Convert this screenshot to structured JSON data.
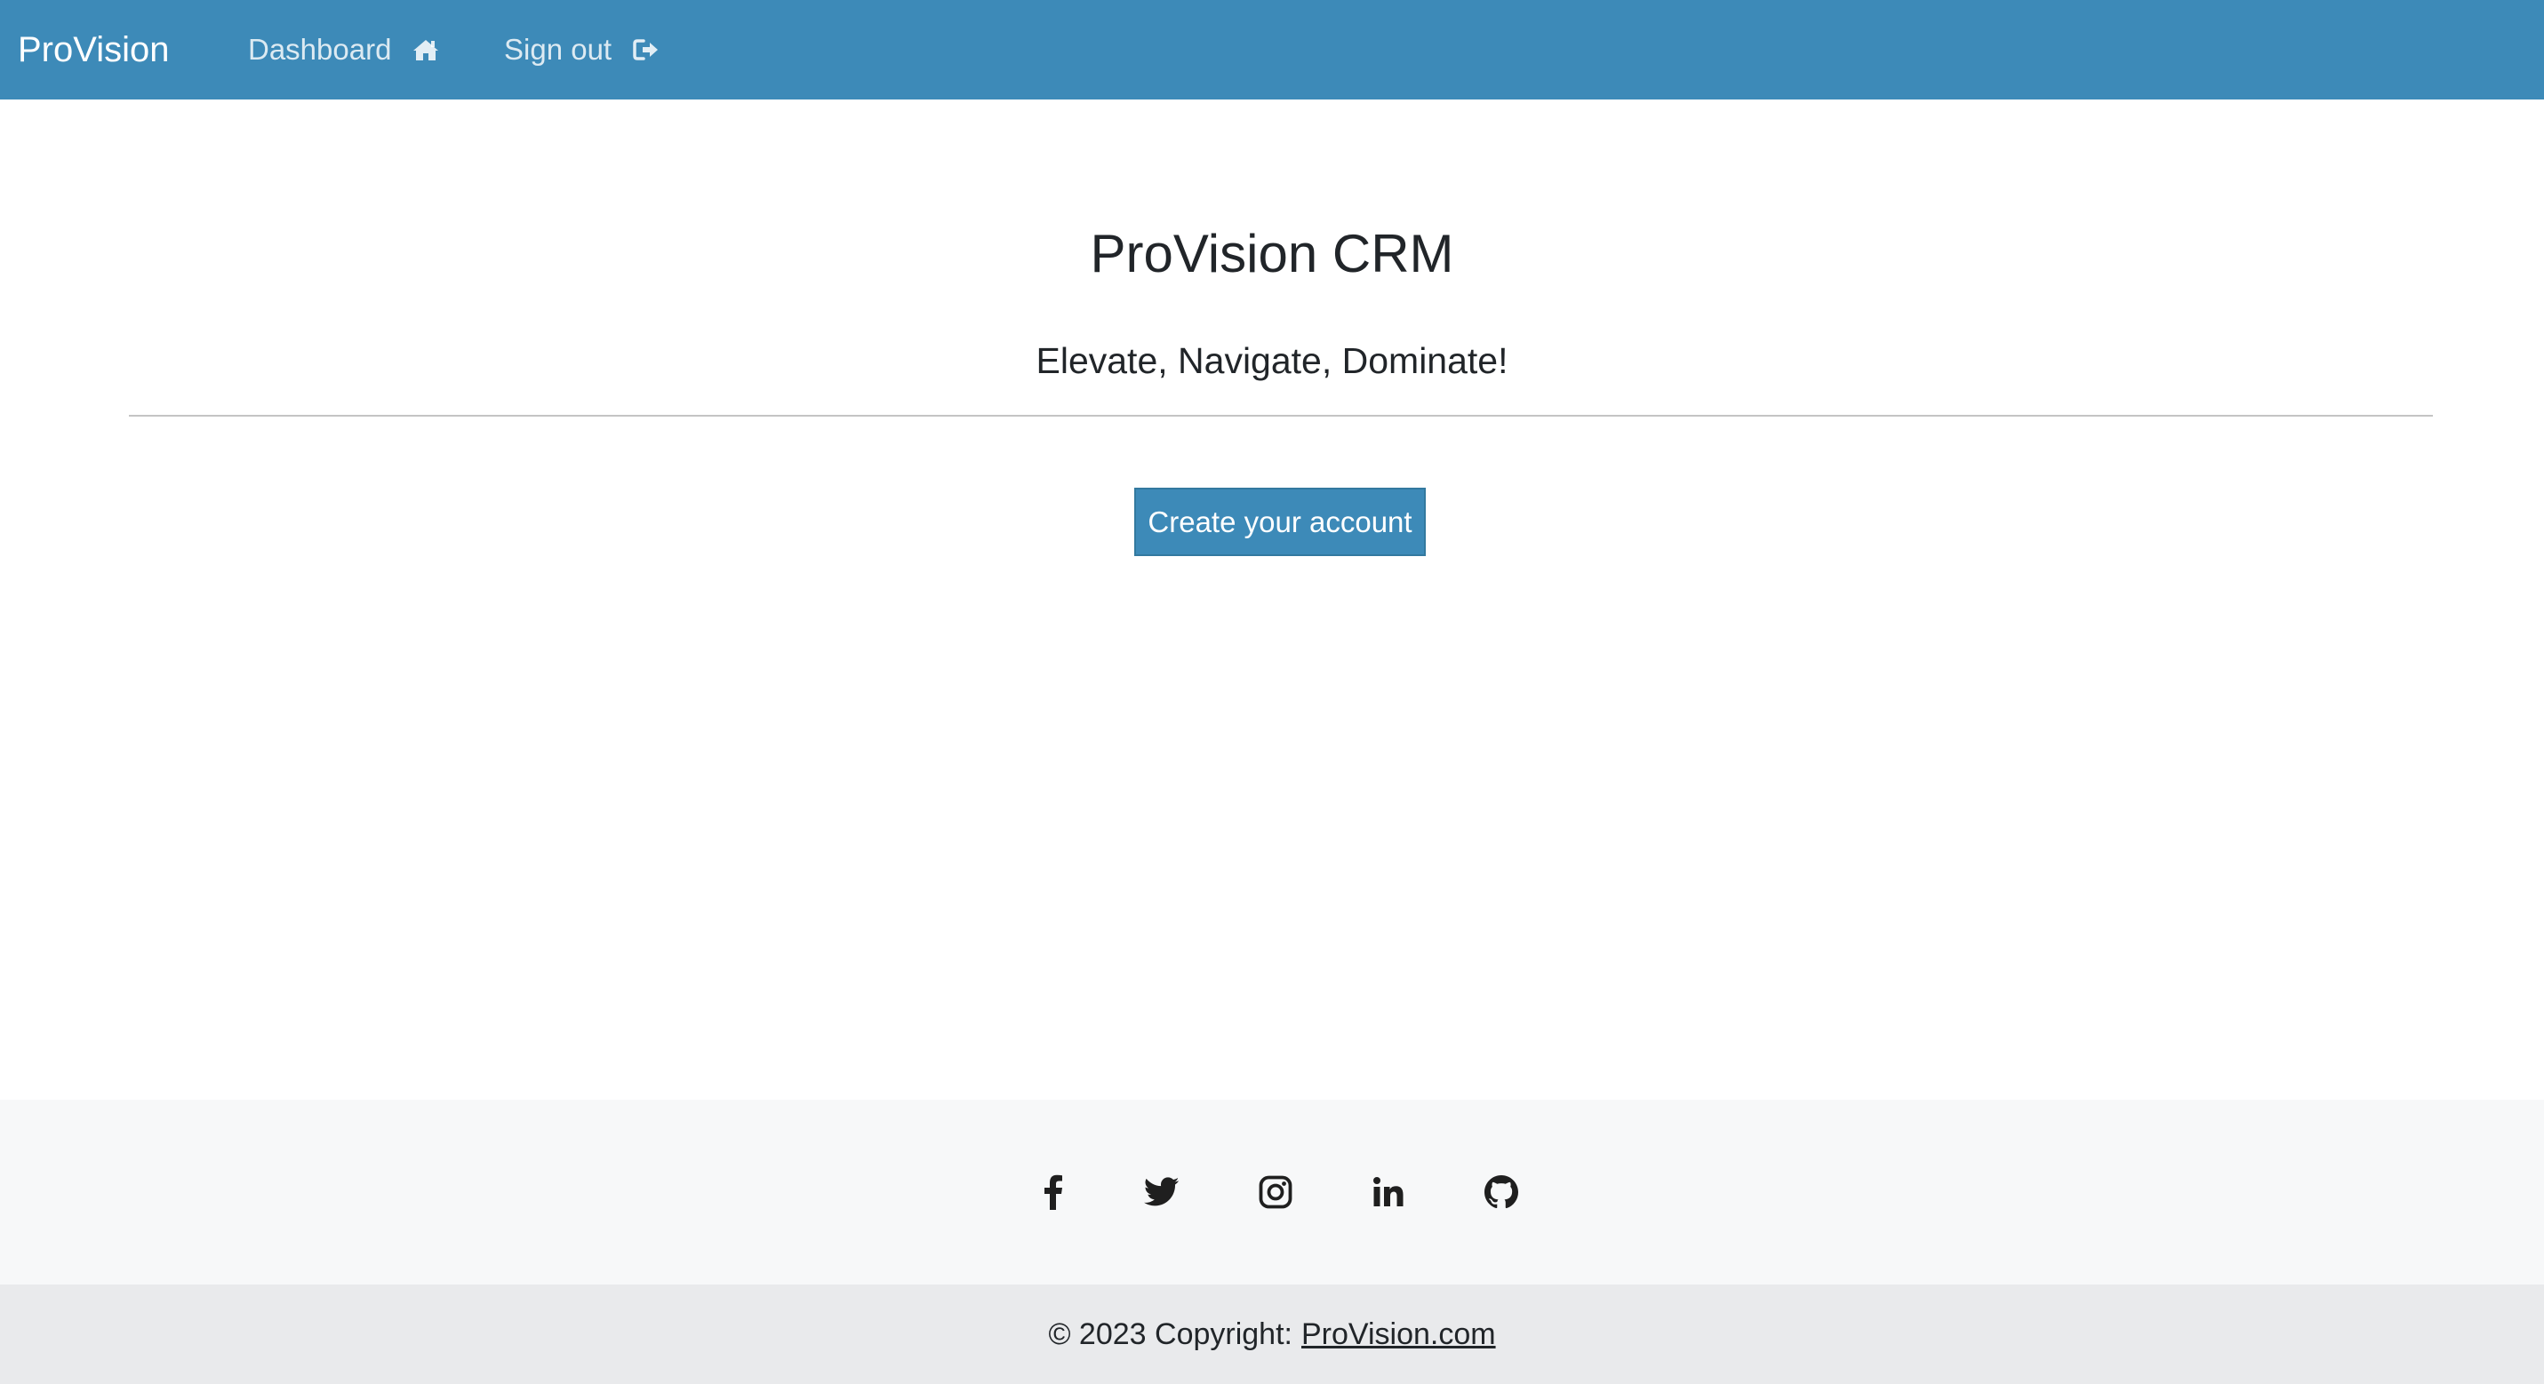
{
  "navbar": {
    "brand": "ProVision",
    "links": [
      {
        "label": "Dashboard",
        "icon": "home-icon"
      },
      {
        "label": "Sign out",
        "icon": "sign-out-icon"
      }
    ],
    "background_color": "#3d8ab8"
  },
  "hero": {
    "title": "ProVision CRM",
    "tagline": "Elevate, Navigate, Dominate!",
    "cta_label": "Create your account",
    "accent_color": "#3d8ab8"
  },
  "footer": {
    "social_icons": [
      "facebook-icon",
      "twitter-icon",
      "instagram-icon",
      "linkedin-icon",
      "github-icon"
    ],
    "copyright_text": "© 2023 Copyright:",
    "copyright_link": "ProVision.com"
  }
}
